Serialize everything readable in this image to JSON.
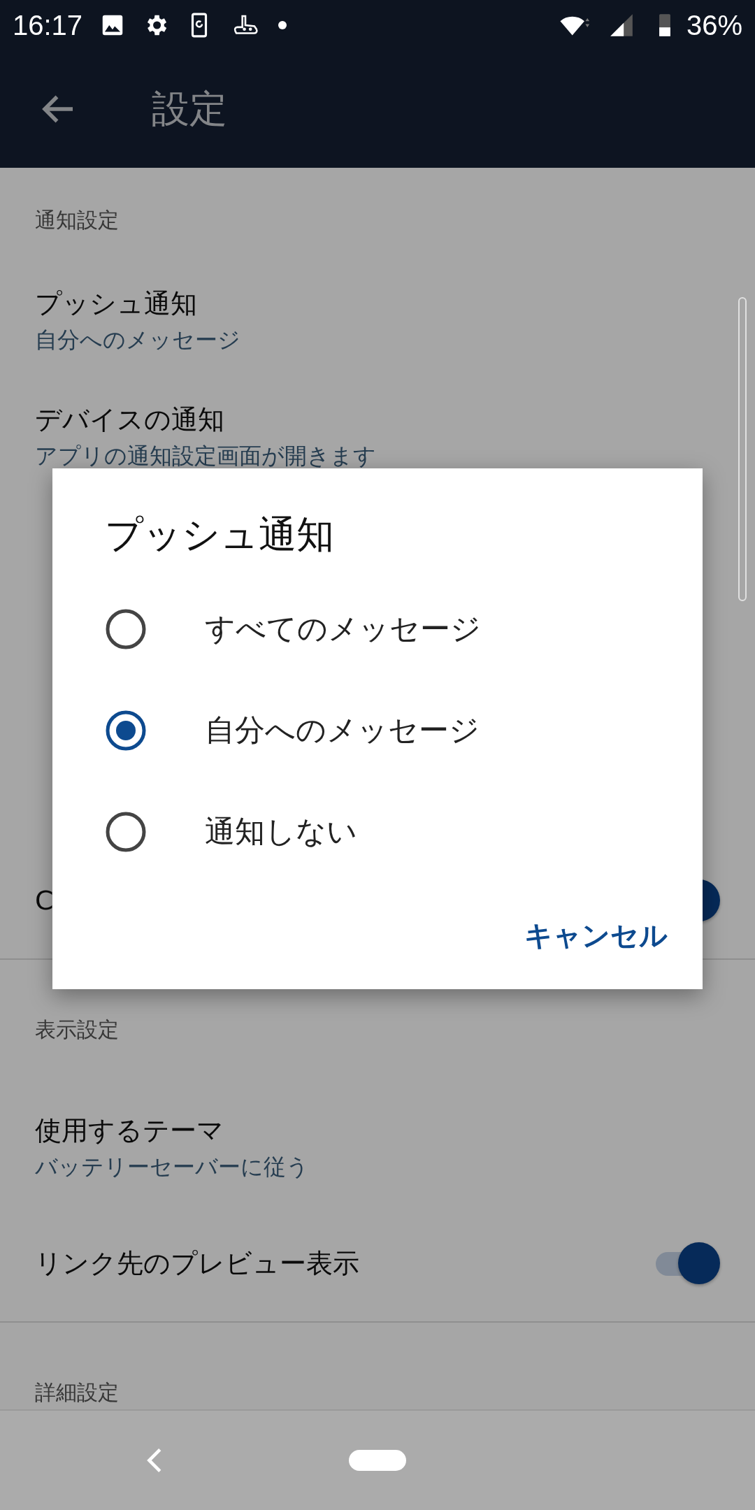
{
  "status_bar": {
    "time": "16:17",
    "battery": "36%"
  },
  "app_bar": {
    "title": "設定"
  },
  "sections": [
    {
      "header": "通知設定",
      "items": [
        {
          "kind": "text",
          "title": "プッシュ通知",
          "subtitle": "自分へのメッセージ"
        },
        {
          "kind": "text",
          "title": "デバイスの通知",
          "subtitle": "アプリの通知設定画面が開きます"
        },
        {
          "kind": "covered"
        },
        {
          "kind": "covered"
        },
        {
          "kind": "covered"
        },
        {
          "kind": "toggle",
          "title": "C",
          "on": true
        }
      ]
    },
    {
      "header": "表示設定",
      "items": [
        {
          "kind": "text",
          "title": "使用するテーマ",
          "subtitle": "バッテリーセーバーに従う"
        },
        {
          "kind": "toggle",
          "title": "リンク先のプレビュー表示",
          "on": true
        }
      ]
    },
    {
      "header": "詳細設定"
    }
  ],
  "dialog": {
    "title": "プッシュ通知",
    "options": [
      {
        "label": "すべてのメッセージ",
        "selected": false
      },
      {
        "label": "自分へのメッセージ",
        "selected": true
      },
      {
        "label": "通知しない",
        "selected": false
      }
    ],
    "button": "キャンセル"
  }
}
